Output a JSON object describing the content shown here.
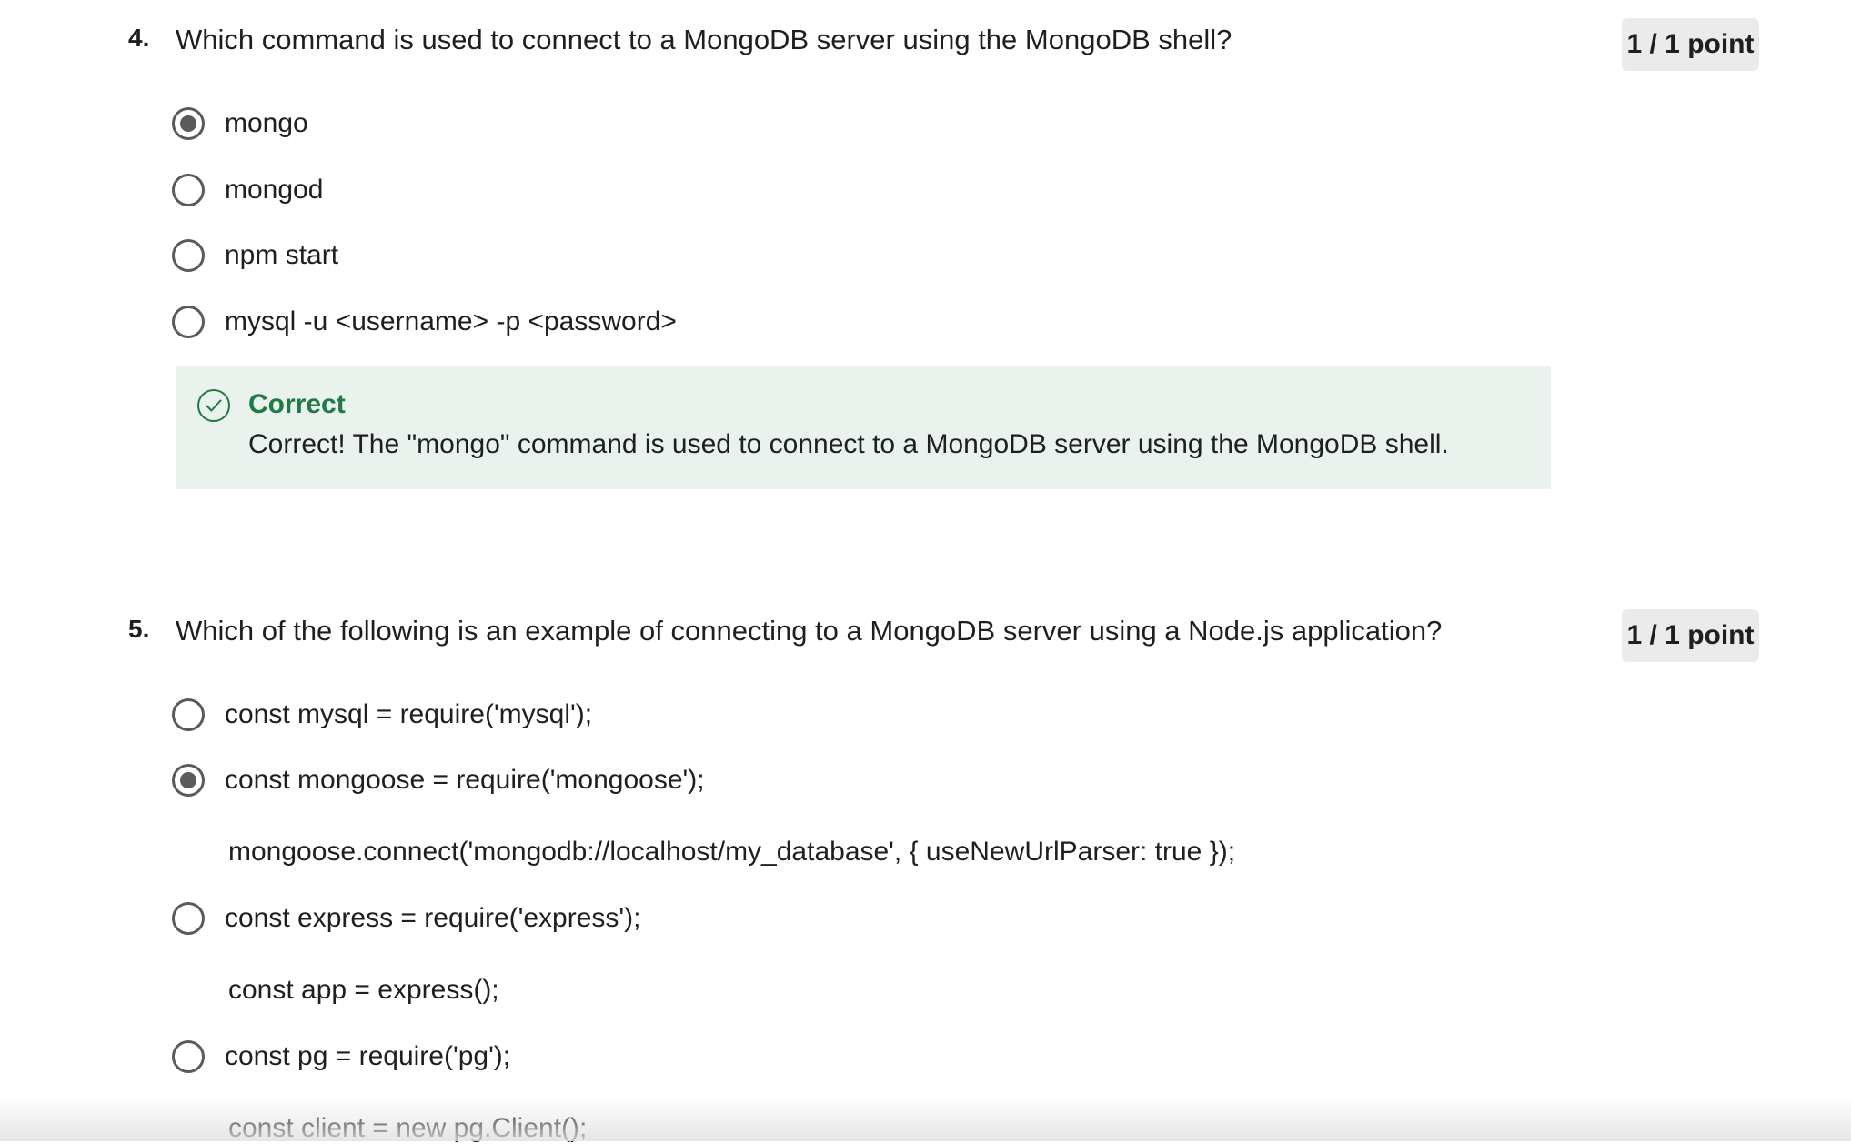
{
  "questions": [
    {
      "number": "4.",
      "text": "Which command is used to connect to a MongoDB server using the MongoDB shell?",
      "points": "1 / 1 point",
      "options": [
        {
          "label": "mongo",
          "selected": true
        },
        {
          "label": "mongod",
          "selected": false
        },
        {
          "label": "npm start",
          "selected": false
        },
        {
          "label": "mysql -u <username> -p <password>",
          "selected": false
        }
      ],
      "feedback": {
        "icon": "check-circle-icon",
        "title": "Correct",
        "text": "Correct! The \"mongo\" command is used to connect to a MongoDB server using the MongoDB shell.",
        "color": "#1f7a46",
        "background": "#e9f2ec"
      }
    },
    {
      "number": "5.",
      "text": "Which of the following is an example of connecting to a MongoDB server using a Node.js application?",
      "points": "1 / 1 point",
      "options": [
        {
          "label": "const mysql = require('mysql');",
          "selected": false
        },
        {
          "label": "const mongoose = require('mongoose');",
          "continuation": "mongoose.connect('mongodb://localhost/my_database', { useNewUrlParser: true });",
          "selected": true
        },
        {
          "label": "const express = require('express');",
          "continuation": "const app = express();",
          "selected": false
        },
        {
          "label": "const pg = require('pg');",
          "continuation": "const client = new pg.Client();",
          "selected": false
        }
      ]
    }
  ]
}
